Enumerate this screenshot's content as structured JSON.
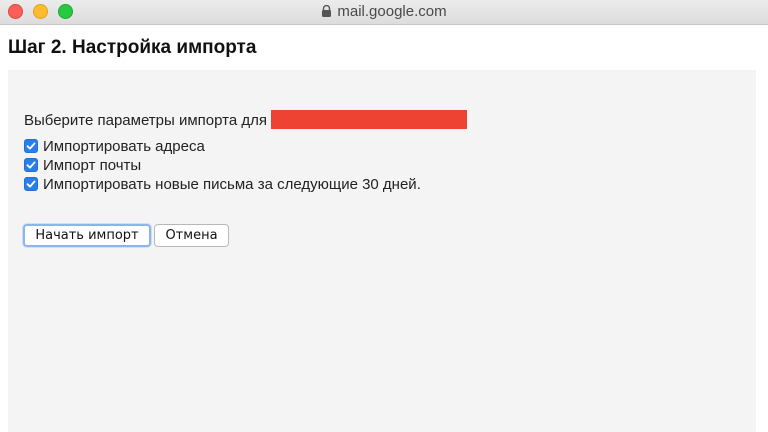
{
  "window": {
    "url": "mail.google.com",
    "icons": {
      "lock": "lock-icon",
      "close": "close-circle",
      "minimize": "minimize-circle",
      "maximize": "maximize-circle"
    },
    "colors": {
      "close": "#fc5f57",
      "minimize": "#fdbc2e",
      "maximize": "#28c840"
    }
  },
  "page": {
    "title": "Шаг 2. Настройка импорта"
  },
  "import": {
    "prompt": "Выберите параметры импорта для",
    "redacted_color": "#ee4232",
    "options": [
      {
        "label": "Импортировать адреса",
        "checked": true
      },
      {
        "label": "Импорт почты",
        "checked": true
      },
      {
        "label": "Импортировать новые письма за следующие 30 дней.",
        "checked": true
      }
    ],
    "checkbox_color": "#2b7de9"
  },
  "actions": {
    "start_label": "Начать импорт",
    "cancel_label": "Отмена"
  }
}
